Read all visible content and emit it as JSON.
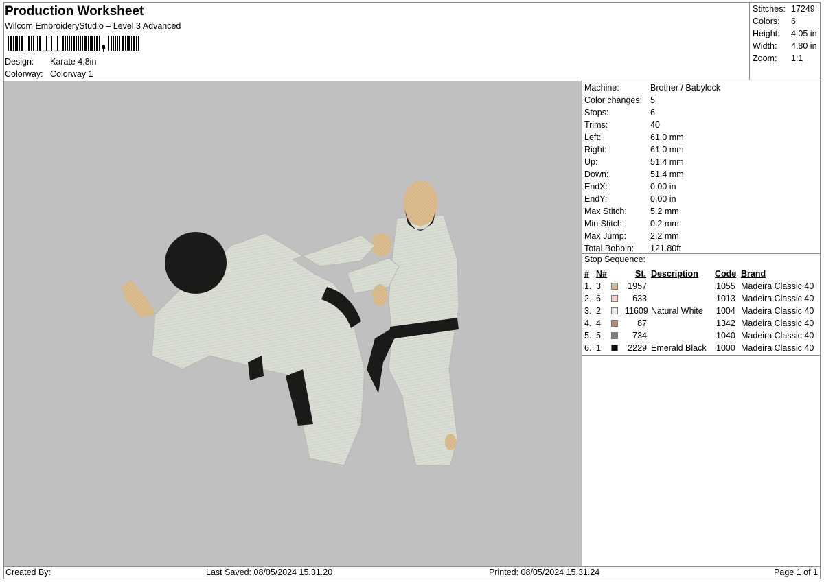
{
  "header": {
    "title": "Production Worksheet",
    "subtitle": "Wilcom EmbroideryStudio – Level 3 Advanced",
    "design_label": "Design:",
    "design_value": "Karate 4,8in",
    "colorway_label": "Colorway:",
    "colorway_value": "Colorway 1"
  },
  "stats": [
    {
      "label": "Stitches:",
      "value": "17249"
    },
    {
      "label": "Colors:",
      "value": "6"
    },
    {
      "label": "Height:",
      "value": "4.05 in"
    },
    {
      "label": "Width:",
      "value": "4.80 in"
    },
    {
      "label": "Zoom:",
      "value": "1:1"
    }
  ],
  "params": [
    {
      "label": "Machine:",
      "value": "Brother / Babylock"
    },
    {
      "label": "Color changes:",
      "value": "5"
    },
    {
      "label": "Stops:",
      "value": "6"
    },
    {
      "label": "Trims:",
      "value": "40"
    },
    {
      "label": "Left:",
      "value": "61.0 mm"
    },
    {
      "label": "Right:",
      "value": "61.0 mm"
    },
    {
      "label": "Up:",
      "value": "51.4 mm"
    },
    {
      "label": "Down:",
      "value": "51.4 mm"
    },
    {
      "label": "EndX:",
      "value": "0.00 in"
    },
    {
      "label": "EndY:",
      "value": "0.00 in"
    },
    {
      "label": "Max Stitch:",
      "value": "5.2 mm"
    },
    {
      "label": "Min Stitch:",
      "value": "0.2 mm"
    },
    {
      "label": "Max Jump:",
      "value": "2.2 mm"
    },
    {
      "label": "Total Bobbin:",
      "value": "121.80ft"
    }
  ],
  "stop_sequence": {
    "title": "Stop Sequence:",
    "columns": {
      "num": "#",
      "n": "N#",
      "st": "St.",
      "description": "Description",
      "code": "Code",
      "brand": "Brand"
    },
    "rows": [
      {
        "num": "1.",
        "n": "3",
        "color": "#d9b48a",
        "st": "1957",
        "description": "",
        "code": "1055",
        "brand": "Madeira Classic 40"
      },
      {
        "num": "2.",
        "n": "6",
        "color": "#f3d2cc",
        "st": "633",
        "description": "",
        "code": "1013",
        "brand": "Madeira Classic 40"
      },
      {
        "num": "3.",
        "n": "2",
        "color": "#e9e9ee",
        "st": "11609",
        "description": "Natural White",
        "code": "1004",
        "brand": "Madeira Classic 40"
      },
      {
        "num": "4.",
        "n": "4",
        "color": "#b58a7a",
        "st": "87",
        "description": "",
        "code": "1342",
        "brand": "Madeira Classic 40"
      },
      {
        "num": "5.",
        "n": "5",
        "color": "#7f7f7f",
        "st": "734",
        "description": "",
        "code": "1040",
        "brand": "Madeira Classic 40"
      },
      {
        "num": "6.",
        "n": "1",
        "color": "#101010",
        "st": "2229",
        "description": "Emerald Black",
        "code": "1000",
        "brand": "Madeira Classic 40"
      }
    ]
  },
  "footer": {
    "created_by": "Created By:",
    "last_saved": "Last Saved: 08/05/2024 15.31.20",
    "printed": "Printed: 08/05/2024 15.31.24",
    "page": "Page 1 of 1"
  },
  "colors": {
    "design_background": "#c0c0c0",
    "gi_white": "#d9ddd3",
    "skin": "#dbbd8f",
    "belt": "#1a1a18",
    "border": "#8a8a8a"
  }
}
